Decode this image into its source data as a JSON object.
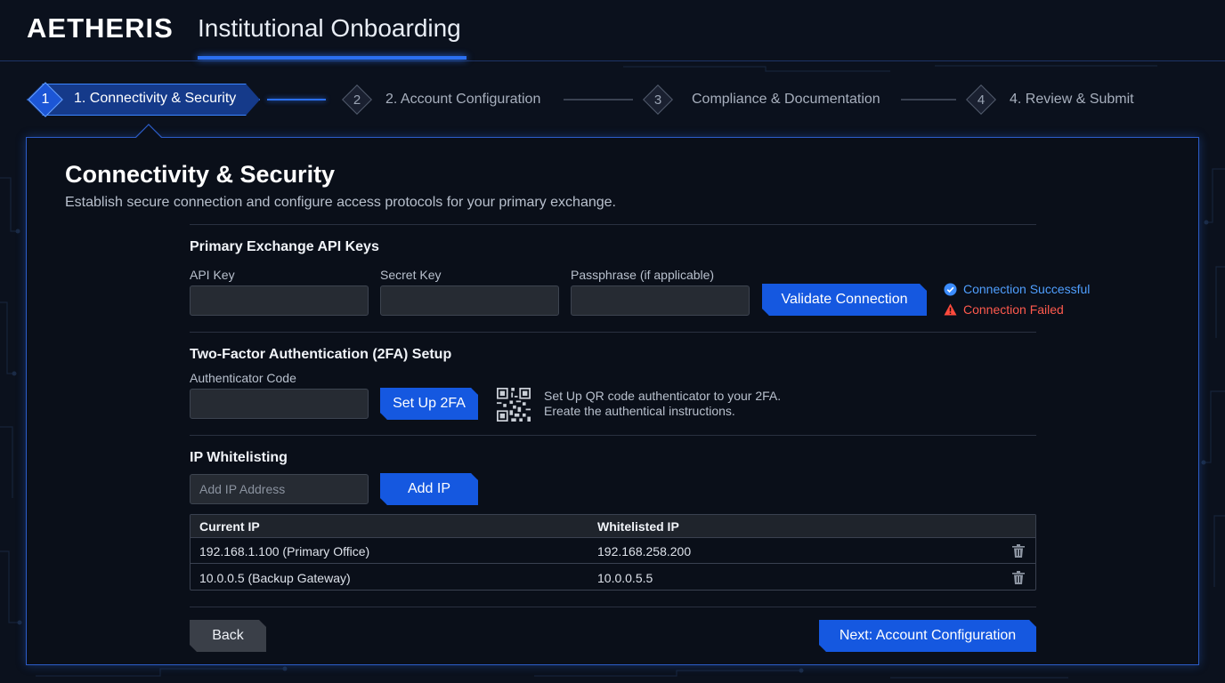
{
  "header": {
    "logo": "AETHERIS",
    "title": "Institutional Onboarding"
  },
  "stepper": {
    "steps": [
      {
        "number": "1",
        "label": "1. Connectivity & Security",
        "state": "active"
      },
      {
        "number": "2",
        "label": "2. Account Configuration",
        "state": "inactive"
      },
      {
        "number": "3",
        "label": "Compliance & Documentation",
        "state": "inactive"
      },
      {
        "number": "4",
        "label": "4. Review & Submit",
        "state": "inactive"
      }
    ]
  },
  "panel": {
    "title": "Connectivity & Security",
    "subtitle": "Establish secure connection and configure access protocols for your primary exchange."
  },
  "api_keys": {
    "section_title": "Primary Exchange API Keys",
    "api_key_label": "API Key",
    "api_key_value": "",
    "secret_key_label": "Secret Key",
    "secret_key_value": "",
    "passphrase_label": "Passphrase (if applicable)",
    "passphrase_value": "",
    "validate_button": "Validate Connection",
    "status_success": "Connection Successful",
    "status_failed": "Connection Failed"
  },
  "two_factor": {
    "section_title": "Two-Factor Authentication (2FA) Setup",
    "code_label": "Authenticator Code",
    "code_value": "",
    "setup_button": "Set Up 2FA",
    "qr_text_line1": "Set Up QR code authenticator to your 2FA.",
    "qr_text_line2": "Ereate the authentical instructions."
  },
  "ip_whitelist": {
    "section_title": "IP Whitelisting",
    "input_placeholder": "Add IP Address",
    "add_button": "Add IP",
    "columns": [
      "Current IP",
      "Whitelisted IP"
    ],
    "rows": [
      {
        "current": "192.168.1.100 (Primary Office)",
        "whitelisted": "192.168.258.200"
      },
      {
        "current": "10.0.0.5 (Backup Gateway)",
        "whitelisted": "10.0.0.5.5"
      }
    ]
  },
  "footer": {
    "back_button": "Back",
    "next_button": "Next: Account Configuration"
  },
  "colors": {
    "accent": "#1558e0",
    "success": "#4f9fff",
    "error": "#ff5a4d",
    "background": "#0b111d"
  }
}
